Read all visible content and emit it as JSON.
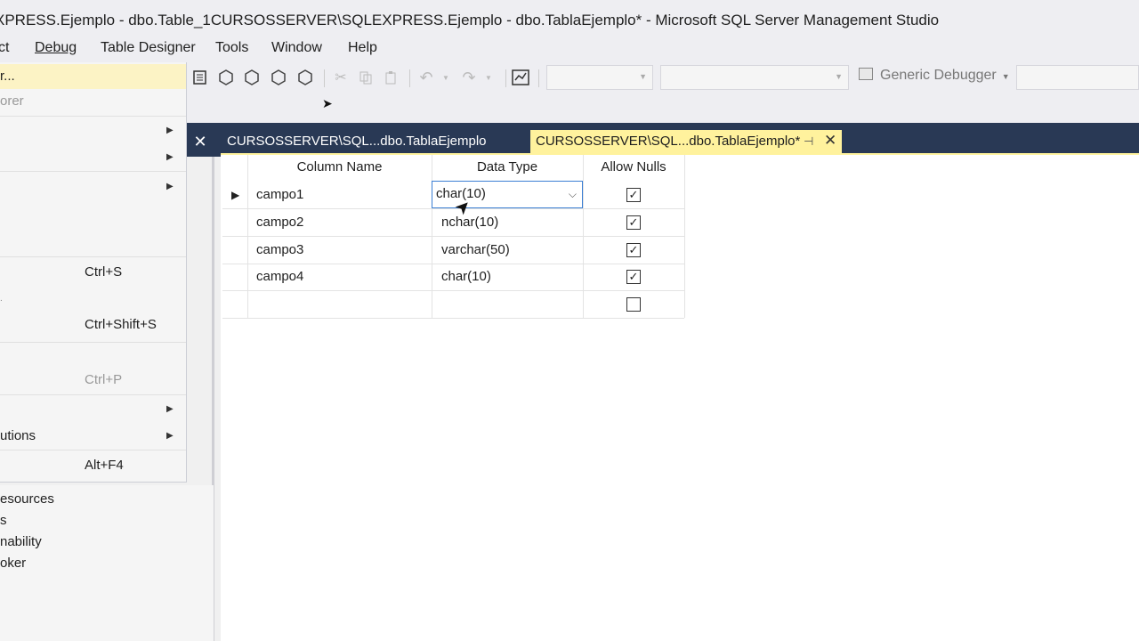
{
  "window": {
    "title": "XPRESS.Ejemplo - dbo.Table_1CURSOSSERVER\\SQLEXPRESS.Ejemplo - dbo.TablaEjemplo* - Microsoft SQL Server Management Studio"
  },
  "menubar": {
    "items": [
      "ct",
      "Debug",
      "Table Designer",
      "Tools",
      "Window",
      "Help"
    ]
  },
  "toolbar": {
    "icons": [
      "save-results-icon",
      "mdx-query-icon",
      "dmx-query-icon",
      "xmla-query-icon",
      "dax-query-icon",
      "cut-icon",
      "copy-icon",
      "paste-icon",
      "undo-icon",
      "redo-icon",
      "object-explorer-icon"
    ],
    "icon_labels": [
      "",
      "MDX",
      "DMX",
      "XMLA",
      "DAX"
    ],
    "debugger_label": "Generic Debugger"
  },
  "file_menu": {
    "items": [
      {
        "label": "r...",
        "shortcut": "",
        "submenu": false,
        "highlighted": true
      },
      {
        "label": "orer",
        "shortcut": "",
        "submenu": false,
        "highlighted": false,
        "disabled": true
      },
      {
        "label": "",
        "shortcut": "",
        "submenu": true
      },
      {
        "label": "",
        "shortcut": "",
        "submenu": true
      },
      {
        "label": "",
        "shortcut": "",
        "submenu": true
      },
      {
        "label": "",
        "shortcut": "Ctrl+S",
        "submenu": false
      },
      {
        "label": ".",
        "shortcut": "",
        "submenu": false
      },
      {
        "label": "",
        "shortcut": "Ctrl+Shift+S",
        "submenu": false
      },
      {
        "label": "",
        "shortcut": "Ctrl+P",
        "submenu": false,
        "disabled": true
      },
      {
        "label": "",
        "shortcut": "",
        "submenu": true
      },
      {
        "label": "utions",
        "shortcut": "",
        "submenu": true
      },
      {
        "label": "",
        "shortcut": "Alt+F4",
        "submenu": false
      }
    ]
  },
  "left_panel": {
    "items": [
      "esources",
      "s",
      "nability",
      "oker"
    ]
  },
  "tabs": [
    {
      "label": "CURSOSSERVER\\SQL...dbo.TablaEjemplo",
      "active": false
    },
    {
      "label": "CURSOSSERVER\\SQL...dbo.TablaEjemplo*",
      "active": true
    }
  ],
  "designer": {
    "columns": [
      "Column Name",
      "Data Type",
      "Allow Nulls"
    ],
    "rows": [
      {
        "name": "campo1",
        "type": "char(10)",
        "nulls": "✓",
        "selected": true
      },
      {
        "name": "campo2",
        "type": "nchar(10)",
        "nulls": "✓"
      },
      {
        "name": "campo3",
        "type": "varchar(50)",
        "nulls": "✓"
      },
      {
        "name": "campo4",
        "type": "char(10)",
        "nulls": "✓"
      },
      {
        "name": "",
        "type": "",
        "nulls": ""
      }
    ]
  },
  "colors": {
    "active_tab": "#fff29d",
    "doc_well": "#293955",
    "menu_highlight": "#fcf3c5"
  }
}
